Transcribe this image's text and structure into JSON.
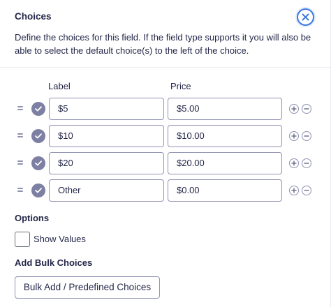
{
  "panel": {
    "title": "Choices",
    "description": "Define the choices for this field. If the field type supports it you will also be able to select the default choice(s) to the left of the choice."
  },
  "columns": {
    "label_header": "Label",
    "price_header": "Price"
  },
  "choices": [
    {
      "label": "$5",
      "price": "$5.00",
      "selected": true
    },
    {
      "label": "$10",
      "price": "$10.00",
      "selected": true
    },
    {
      "label": "$20",
      "price": "$20.00",
      "selected": true
    },
    {
      "label": "Other",
      "price": "$0.00",
      "selected": true
    }
  ],
  "options": {
    "heading": "Options",
    "show_values_label": "Show Values",
    "show_values_checked": false
  },
  "bulk": {
    "heading": "Add Bulk Choices",
    "button_label": "Bulk Add / Predefined Choices"
  },
  "icons": {
    "close": "close-icon",
    "drag": "drag-handle-icon",
    "check": "checkmark-icon",
    "add": "plus-icon",
    "remove": "minus-icon"
  },
  "colors": {
    "accent": "#3e7bde",
    "text": "#242748",
    "border": "#9092b2",
    "check_fill": "#7d7fa3"
  }
}
